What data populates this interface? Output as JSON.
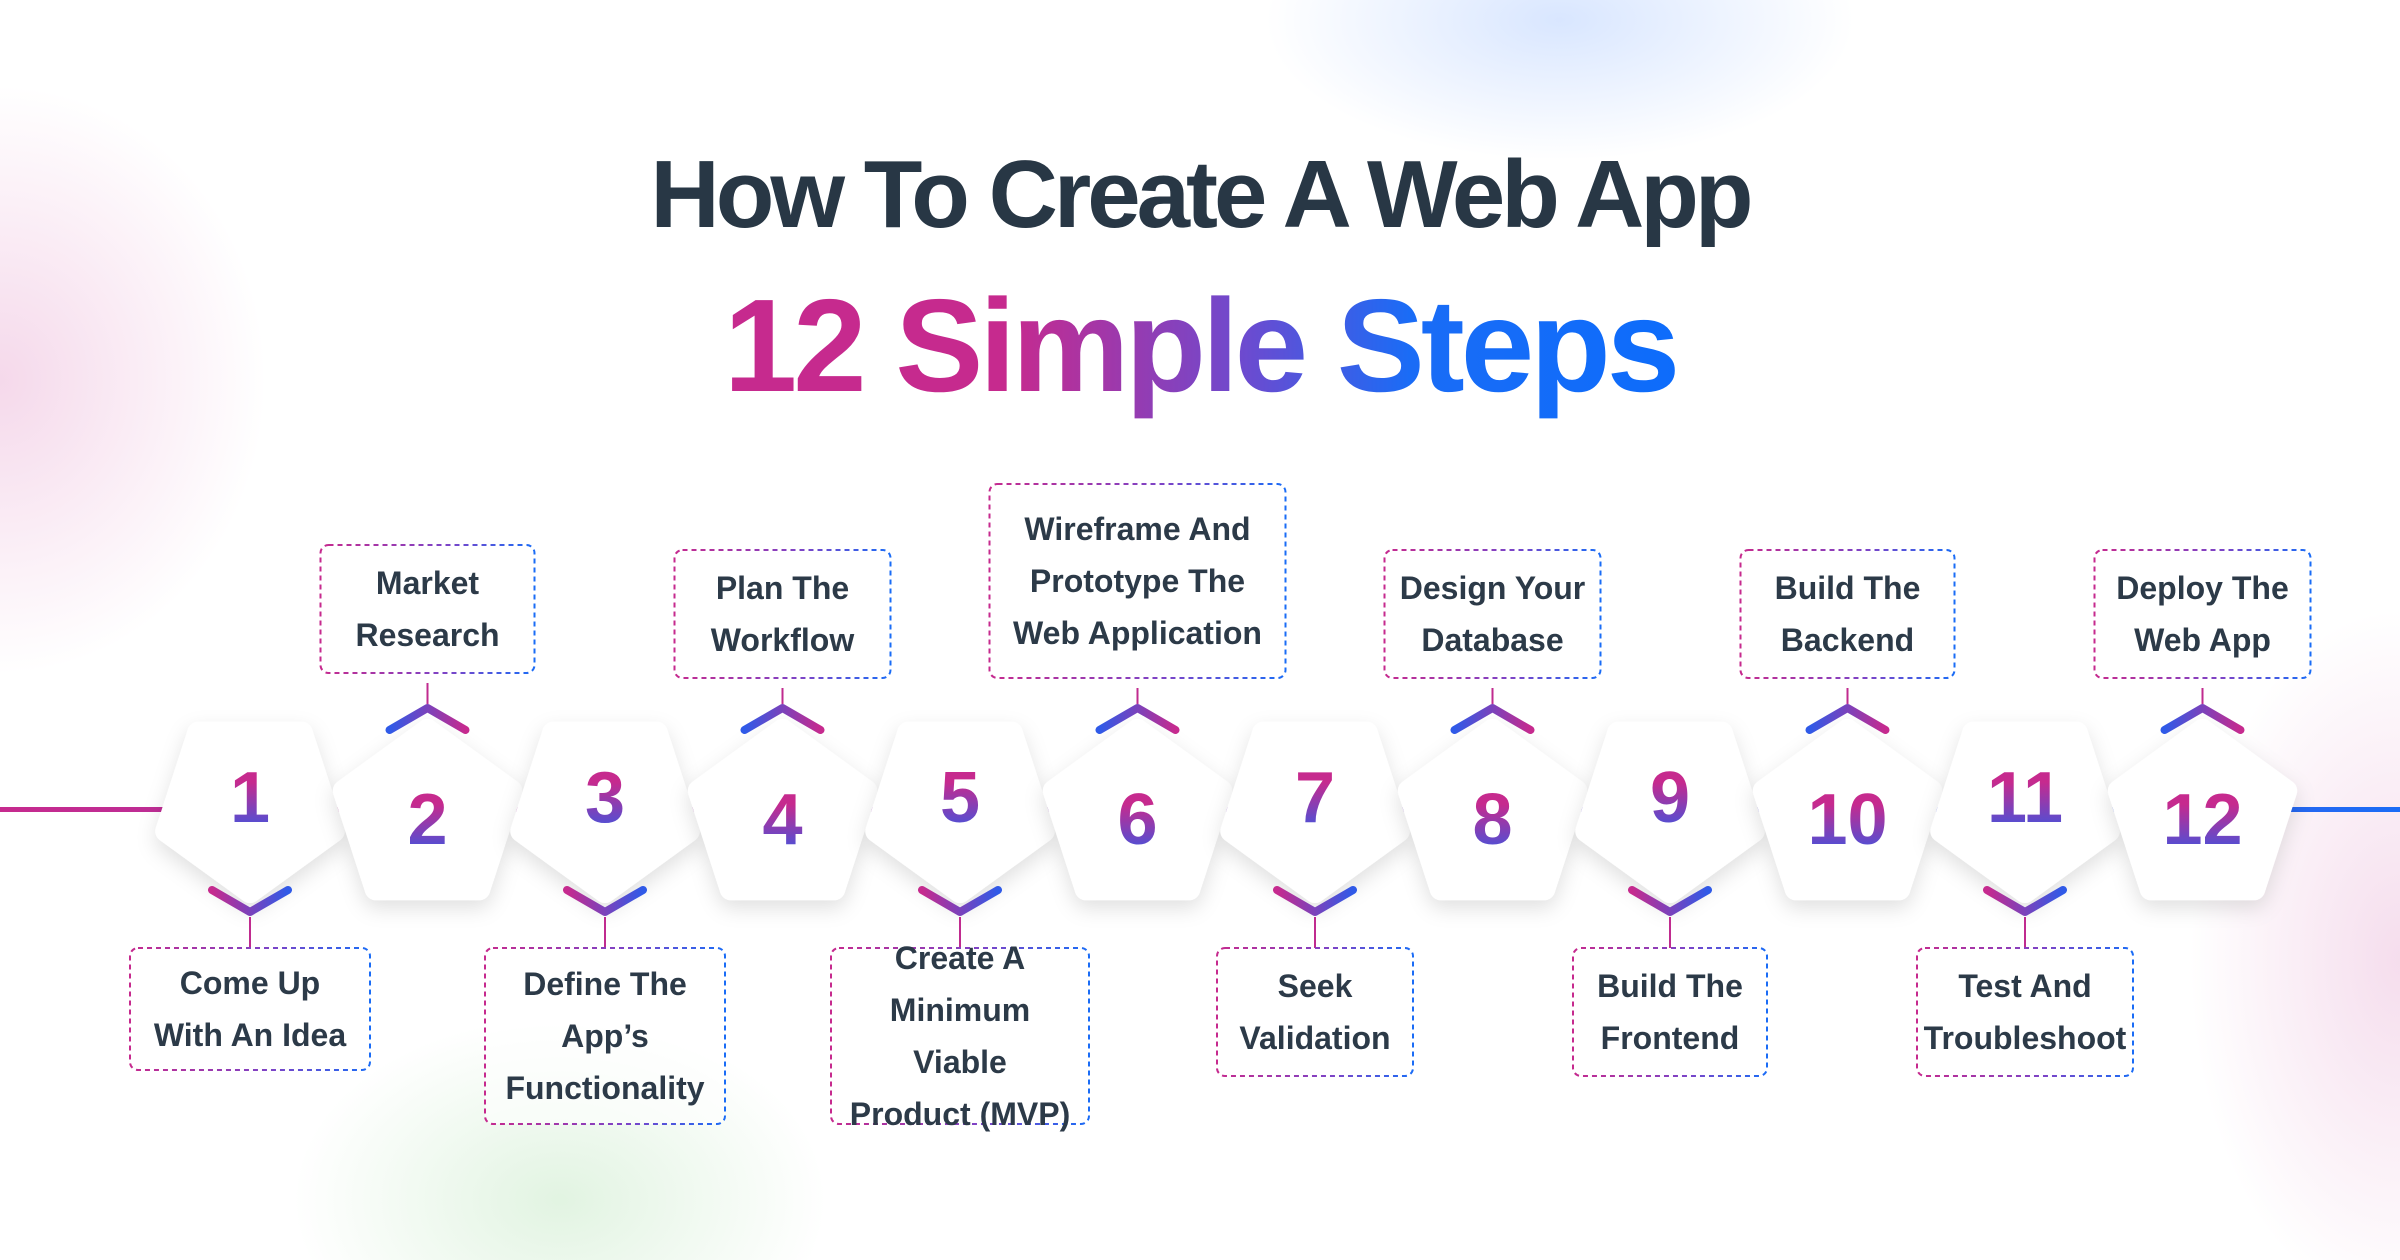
{
  "title_line1": "How To Create A Web App",
  "title_line2": "12 Simple Steps",
  "colors": {
    "magenta": "#c62a8e",
    "purple": "#7a44c8",
    "blue": "#1a6cf6",
    "text": "#283745"
  },
  "steps": [
    {
      "number": "1",
      "label": "Come Up\nWith An Idea"
    },
    {
      "number": "2",
      "label": "Market\nResearch"
    },
    {
      "number": "3",
      "label": "Define The\nApp’s\nFunctionality"
    },
    {
      "number": "4",
      "label": "Plan The\nWorkflow"
    },
    {
      "number": "5",
      "label": "Create A\nMinimum Viable\nProduct (MVP)"
    },
    {
      "number": "6",
      "label": "Wireframe And\nPrototype The\nWeb Application"
    },
    {
      "number": "7",
      "label": "Seek\nValidation"
    },
    {
      "number": "8",
      "label": "Design Your\nDatabase"
    },
    {
      "number": "9",
      "label": "Build The\nFrontend"
    },
    {
      "number": "10",
      "label": "Build The\nBackend"
    },
    {
      "number": "11",
      "label": "Test And\nTroubleshoot"
    },
    {
      "number": "12",
      "label": "Deploy The\nWeb App"
    }
  ]
}
